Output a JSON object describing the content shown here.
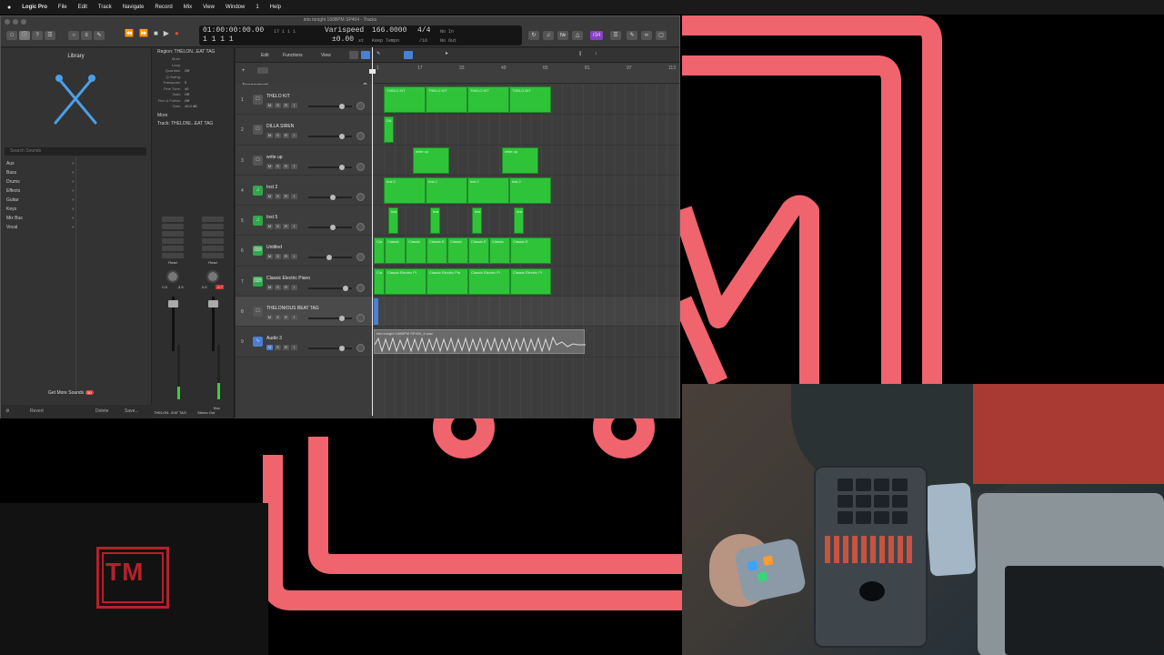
{
  "colors": {
    "logo_pink": "#f0646e",
    "region_green": "#2fc33a",
    "tm_red": "#b5212a"
  },
  "menubar": {
    "apple": "",
    "items": [
      "Logic Pro",
      "File",
      "Edit",
      "Track",
      "Navigate",
      "Record",
      "Mix",
      "View",
      "Window",
      "1",
      "Help"
    ]
  },
  "window": {
    "title": "into tonight 166BPM SP404 - Tracks"
  },
  "lcd": {
    "time": "01:00:00:00.00",
    "bars": "1  1  1     1",
    "pos2": "17  1  1     1",
    "varispeed": "Varispeed",
    "varispeed_val": "±0.00",
    "varispeed_unit": "st",
    "keep_tempo": "Keep Tempo",
    "tempo": "166.0000",
    "sig_top": "4/4",
    "sig_bottom": "/16",
    "no_in": "No In",
    "no_out": "No Out",
    "badge": "r34"
  },
  "library": {
    "title": "Library",
    "search_placeholder": "Search Sounds",
    "categories": [
      "Aux",
      "Bass",
      "Drums",
      "Effects",
      "Guitar",
      "Keys",
      "Mix Bus",
      "Vocal"
    ],
    "get_more": "Get More Sounds",
    "get_more_badge": "50",
    "revert": "Revert",
    "delete": "Delete",
    "save": "Save..."
  },
  "inspector": {
    "region_head": "Region: THELON...EAT TAG",
    "rows": [
      {
        "k": "Mute:",
        "v": ""
      },
      {
        "k": "Loop:",
        "v": ""
      },
      {
        "k": "Quantize:",
        "v": "Off"
      },
      {
        "k": "Q-Swing:",
        "v": ""
      },
      {
        "k": "Transpose:",
        "v": "0"
      },
      {
        "k": "Fine Tune:",
        "v": "±0"
      },
      {
        "k": "Gain:",
        "v": "Off"
      },
      {
        "k": "Flex & Follow:",
        "v": "Off"
      },
      {
        "k": "Gain:",
        "v": "±0.0 dB"
      }
    ],
    "more_head": "More",
    "track_head": "Track: THELONI...EAT TAG",
    "strip1_name": "THELON...EAT TAG",
    "strip2_name": "Stereo Out",
    "read1": "Read",
    "read2": "Read",
    "val1": "0.0",
    "val2": "-3.5",
    "val3": "0.0",
    "val4": "-0.7",
    "bnc": "Bnc"
  },
  "tracks_toolbar": {
    "edit": "Edit",
    "functions": "Functions",
    "view": "View"
  },
  "arrangement": "Arrangement",
  "ruler": [
    {
      "n": "1"
    },
    {
      "n": "17"
    },
    {
      "n": "33"
    },
    {
      "n": "49"
    },
    {
      "n": "65"
    },
    {
      "n": "81"
    },
    {
      "n": "97"
    },
    {
      "n": "113"
    }
  ],
  "tracks": [
    {
      "num": "1",
      "name": "THELO KIT",
      "icon": "drum-machine-icon",
      "type": "plain"
    },
    {
      "num": "2",
      "name": "DILLA SIREN",
      "icon": "drum-machine-icon",
      "type": "plain"
    },
    {
      "num": "3",
      "name": "write up",
      "icon": "drum-machine-icon",
      "type": "plain"
    },
    {
      "num": "4",
      "name": "Inst 2",
      "icon": "music-note-icon",
      "type": "green"
    },
    {
      "num": "5",
      "name": "Inst 5",
      "icon": "music-note-icon",
      "type": "green"
    },
    {
      "num": "6",
      "name": "Untitled",
      "icon": "keyboard-icon",
      "type": "green"
    },
    {
      "num": "7",
      "name": "Classic Electric Piano",
      "icon": "keyboard-icon",
      "type": "green"
    },
    {
      "num": "8",
      "name": "THELONIOUS BEAT TAG",
      "icon": "drum-machine-icon",
      "type": "plain"
    },
    {
      "num": "9",
      "name": "Audio 3",
      "icon": "waveform-icon",
      "type": "blue"
    }
  ],
  "regions": {
    "r1": [
      "THELO KIT",
      "THELO KIT",
      "THELO KIT",
      "THELO KIT"
    ],
    "r2": [
      "DIL"
    ],
    "r3": [
      "write up",
      "write up"
    ],
    "r4": [
      "Inst 2",
      "Inst 2",
      "Inst 2",
      "Inst 2"
    ],
    "r5": [
      "Inst",
      "Inst",
      "Inst",
      "Inst"
    ],
    "r6": [
      "Cla",
      "Classic",
      "Classic",
      "Classic E",
      "Classic",
      "Classic E",
      "Classic",
      "Classic E"
    ],
    "r7": [
      "Cla",
      "Classic Electric Pi",
      "Classic Electric Pia",
      "Classic Electric Pi",
      "Classic Electric Pi"
    ],
    "r9": "into tonight 166BPM SP404_4.wav"
  },
  "tm_logo": "TM"
}
